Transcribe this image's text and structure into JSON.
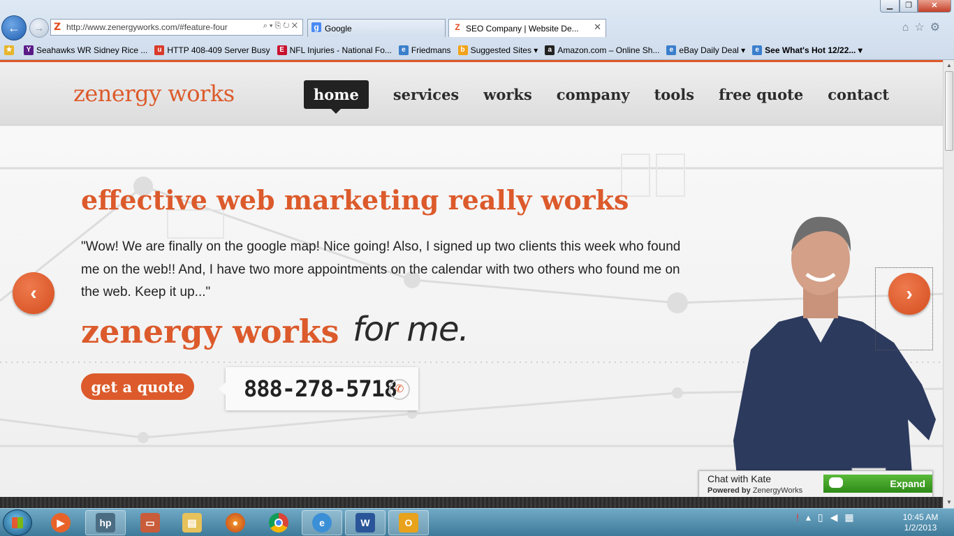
{
  "browser": {
    "address": "http://www.zenergyworks.com/#feature-four",
    "tabs": [
      {
        "label": "Google"
      },
      {
        "label": "SEO Company | Website De..."
      }
    ],
    "favorites": [
      "Seahawks WR Sidney Rice ...",
      "HTTP 408-409 Server Busy",
      "NFL Injuries - National Fo...",
      "Friedmans",
      "Suggested Sites",
      "Amazon.com – Online Sh...",
      "eBay Daily Deal",
      "See What's Hot 12/22..."
    ]
  },
  "site": {
    "logo": "zenergy works",
    "menu": [
      "home",
      "services",
      "works",
      "company",
      "tools",
      "free quote",
      "contact"
    ],
    "active_menu": "home"
  },
  "hero": {
    "headline": "effective web marketing really works",
    "quote": "\"Wow! We are finally on the google map! Nice going! Also, I signed up two clients this week who found me on the web!! And, I have two more appointments on the calendar with two others who found me on the web. Keep it up...\"",
    "tagline_brand": "zenergy works",
    "tagline_script": "for me.",
    "cta": "get a quote",
    "phone": "888-278-5718"
  },
  "chat": {
    "title": "Chat with Kate",
    "powered_prefix": "Powered by",
    "powered_name": "ZenergyWorks",
    "expand": "Expand"
  },
  "taskbar": {
    "time": "10:45 AM",
    "date": "1/2/2013"
  },
  "colors": {
    "brand_orange": "#dc5a2b",
    "header_dark": "#222222",
    "chat_green": "#3f9e26"
  }
}
